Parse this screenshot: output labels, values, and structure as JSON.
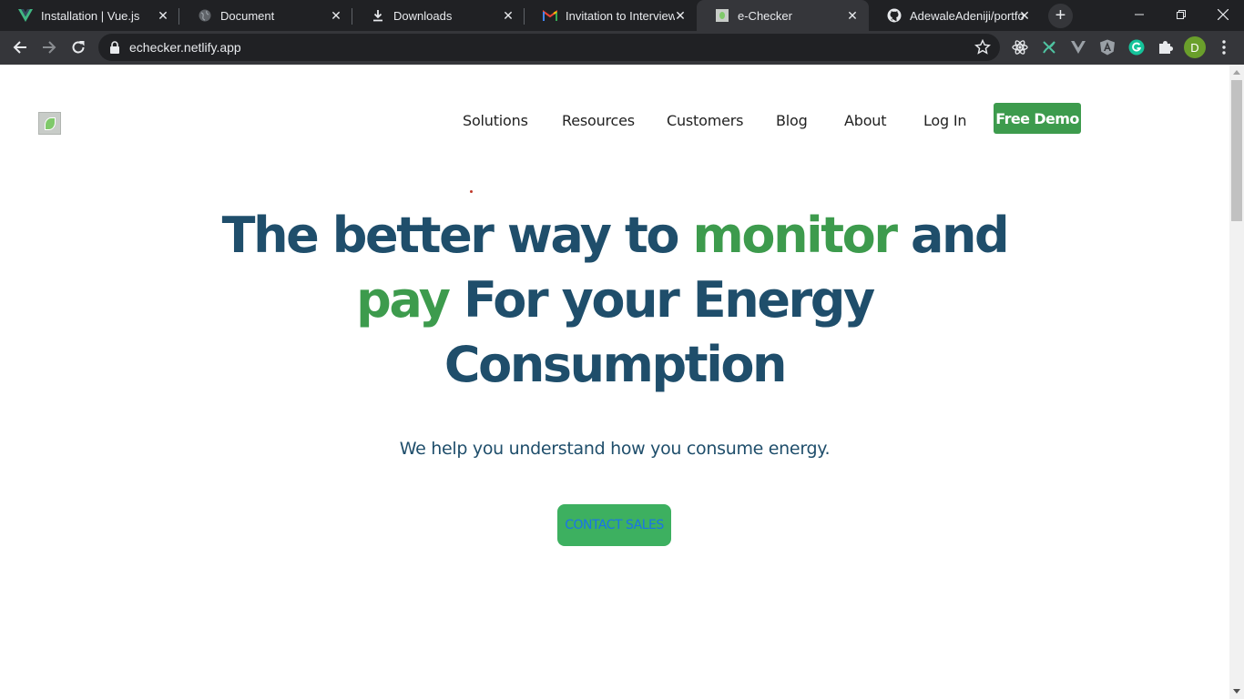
{
  "browser": {
    "tabs": [
      {
        "title": "Installation | Vue.js",
        "icon": "vue-logo-icon"
      },
      {
        "title": "Document",
        "icon": "globe-icon"
      },
      {
        "title": "Downloads",
        "icon": "download-icon"
      },
      {
        "title": "Invitation to Interview -",
        "icon": "gmail-icon"
      },
      {
        "title": "e-Checker",
        "icon": "page-thumbnail-icon",
        "active": true
      },
      {
        "title": "AdewaleAdeniji/portfoli",
        "icon": "github-icon"
      }
    ],
    "address": "echecker.netlify.app",
    "profile_initial": "D"
  },
  "site": {
    "nav": [
      "Solutions",
      "Resources",
      "Customers",
      "Blog",
      "About",
      "Log In"
    ],
    "demo_button": "Free Demo",
    "hero": {
      "part1": "The better way to ",
      "accent1": "monitor",
      "part2": " and",
      "accent2": "pay",
      "part3": " For your Energy",
      "part4": "Consumption"
    },
    "subtitle": "We help you understand how you consume energy.",
    "cta": "CONTACT SALES"
  },
  "colors": {
    "brand_green": "#3d9b4d",
    "heading_blue": "#1f4e6b",
    "cta_green": "#3db060",
    "cta_text": "#1a73e8"
  }
}
